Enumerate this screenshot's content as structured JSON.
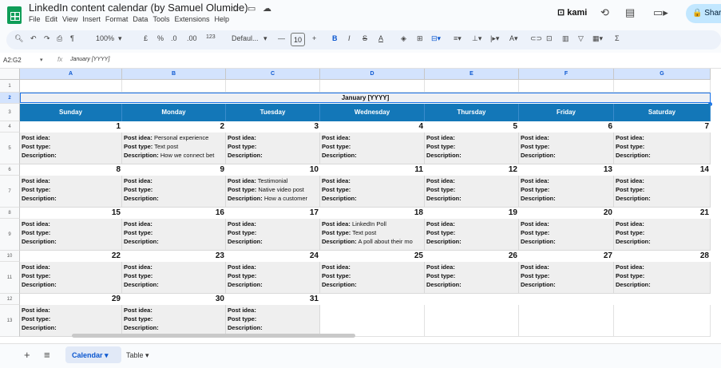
{
  "app": {
    "title": "LinkedIn content calendar (by Samuel Olumide)",
    "menu": [
      "File",
      "Edit",
      "View",
      "Insert",
      "Format",
      "Data",
      "Tools",
      "Extensions",
      "Help"
    ],
    "kami_label": "kami",
    "share_label": "Shar"
  },
  "toolbar": {
    "zoom": "100%",
    "currency": "£",
    "percent": "%",
    "dec_decrease": ".0",
    "dec_increase": ".00",
    "number_format": "123",
    "font": "Defaul...",
    "font_size": "10",
    "sigma": "Σ"
  },
  "formula_bar": {
    "name_box": "A2:G2",
    "fx": "fx",
    "value": "January [YYYY]"
  },
  "columns": [
    "A",
    "B",
    "C",
    "D",
    "E",
    "F",
    "G"
  ],
  "rows": [
    "1",
    "2",
    "3",
    "4",
    "5",
    "6",
    "7",
    "8",
    "9",
    "10",
    "11",
    "12",
    "13"
  ],
  "calendar": {
    "title": "January [YYYY]",
    "days": [
      "Sunday",
      "Monday",
      "Tuesday",
      "Wednesday",
      "Thursday",
      "Friday",
      "Saturday"
    ],
    "weeks": [
      {
        "dates": [
          "1",
          "2",
          "3",
          "4",
          "5",
          "6",
          "7"
        ],
        "cells": [
          {
            "idea": "",
            "type": "",
            "desc": ""
          },
          {
            "idea": "Personal experience",
            "type": "Text post",
            "desc": "How we connect bet"
          },
          {
            "idea": "",
            "type": "",
            "desc": ""
          },
          {
            "idea": "",
            "type": "",
            "desc": ""
          },
          {
            "idea": "",
            "type": "",
            "desc": ""
          },
          {
            "idea": "",
            "type": "",
            "desc": ""
          },
          {
            "idea": "",
            "type": "",
            "desc": ""
          }
        ]
      },
      {
        "dates": [
          "8",
          "9",
          "10",
          "11",
          "12",
          "13",
          "14"
        ],
        "cells": [
          {
            "idea": "",
            "type": "",
            "desc": ""
          },
          {
            "idea": "",
            "type": "",
            "desc": ""
          },
          {
            "idea": "Testimonial",
            "type": "Native video post",
            "desc": "How a customer"
          },
          {
            "idea": "",
            "type": "",
            "desc": ""
          },
          {
            "idea": "",
            "type": "",
            "desc": ""
          },
          {
            "idea": "",
            "type": "",
            "desc": ""
          },
          {
            "idea": "",
            "type": "",
            "desc": ""
          }
        ]
      },
      {
        "dates": [
          "15",
          "16",
          "17",
          "18",
          "19",
          "20",
          "21"
        ],
        "cells": [
          {
            "idea": "",
            "type": "",
            "desc": ""
          },
          {
            "idea": "",
            "type": "",
            "desc": ""
          },
          {
            "idea": "",
            "type": "",
            "desc": ""
          },
          {
            "idea": "LinkedIn Poll",
            "type": "Text post",
            "desc": "A poll about their mo"
          },
          {
            "idea": "",
            "type": "",
            "desc": ""
          },
          {
            "idea": "",
            "type": "",
            "desc": ""
          },
          {
            "idea": "",
            "type": "",
            "desc": ""
          }
        ]
      },
      {
        "dates": [
          "22",
          "23",
          "24",
          "25",
          "26",
          "27",
          "28"
        ],
        "cells": [
          {
            "idea": "",
            "type": "",
            "desc": ""
          },
          {
            "idea": "",
            "type": "",
            "desc": ""
          },
          {
            "idea": "",
            "type": "",
            "desc": ""
          },
          {
            "idea": "",
            "type": "",
            "desc": ""
          },
          {
            "idea": "",
            "type": "",
            "desc": ""
          },
          {
            "idea": "",
            "type": "",
            "desc": ""
          },
          {
            "idea": "",
            "type": "",
            "desc": ""
          }
        ]
      },
      {
        "dates": [
          "29",
          "30",
          "31",
          "",
          "",
          "",
          ""
        ],
        "cells": [
          {
            "idea": "",
            "type": "",
            "desc": ""
          },
          {
            "idea": "",
            "type": "",
            "desc": ""
          },
          {
            "idea": "",
            "type": "",
            "desc": ""
          },
          null,
          null,
          null,
          null
        ]
      }
    ],
    "labels": {
      "idea": "Post idea:",
      "type": "Post type:",
      "desc": "Description:"
    }
  },
  "sheets": {
    "active": "Calendar",
    "other": "Table"
  },
  "colors": {
    "header_blue": "#1377b8",
    "detail_gray": "#efefef",
    "accent": "#1a73e8"
  }
}
